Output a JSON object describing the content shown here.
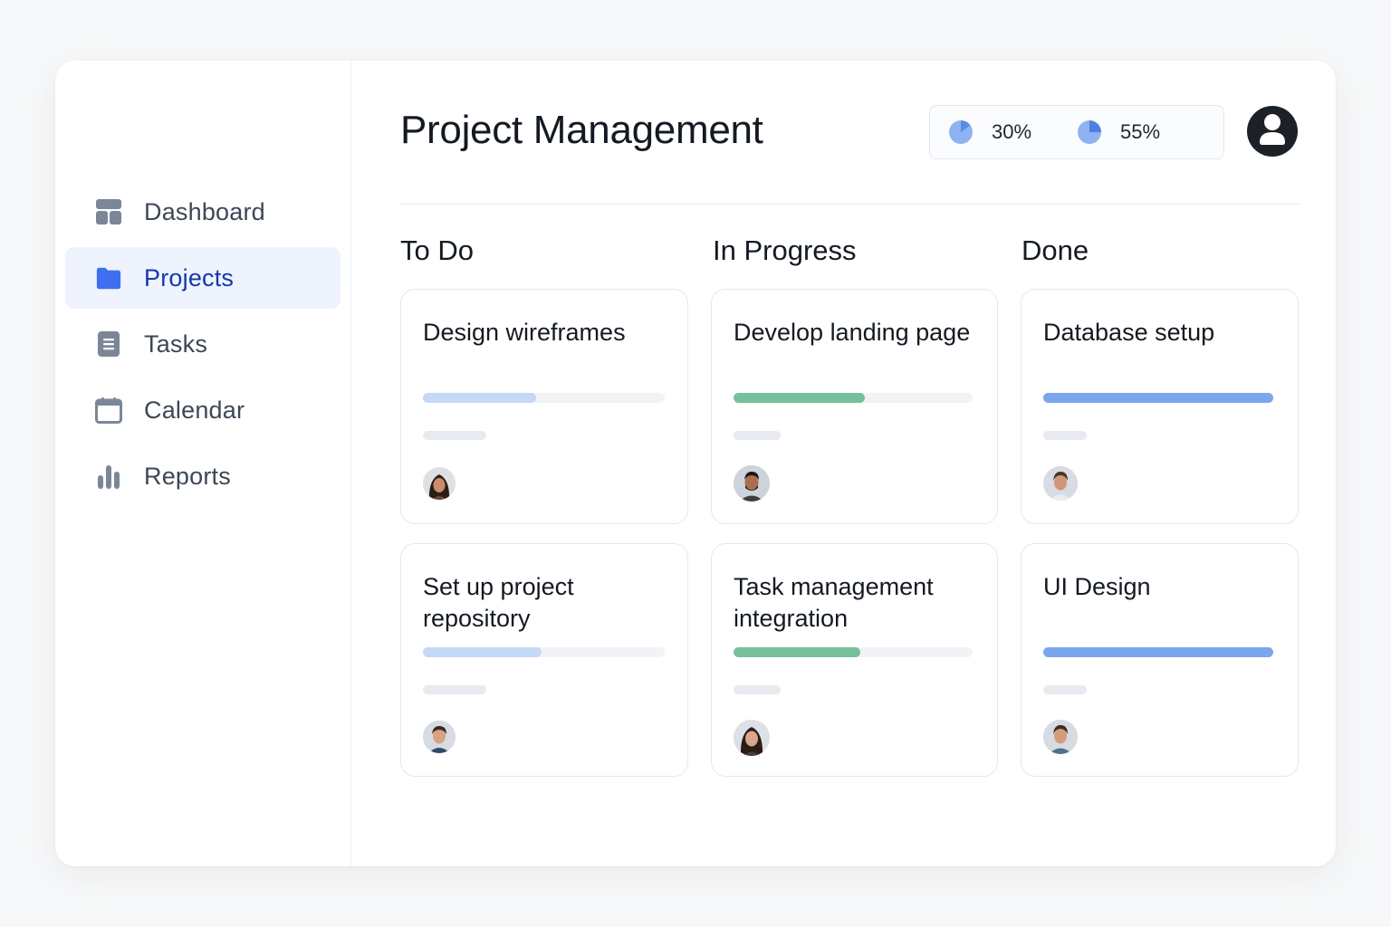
{
  "sidebar": {
    "items": [
      {
        "label": "Dashboard",
        "icon": "dashboard-icon",
        "active": false
      },
      {
        "label": "Projects",
        "icon": "folder-icon",
        "active": true
      },
      {
        "label": "Tasks",
        "icon": "document-icon",
        "active": false
      },
      {
        "label": "Calendar",
        "icon": "calendar-icon",
        "active": false
      },
      {
        "label": "Reports",
        "icon": "bar-chart-icon",
        "active": false
      }
    ]
  },
  "header": {
    "title": "Project Management",
    "stats": [
      {
        "label": "30%",
        "value": 0.3,
        "icon": "pie-chart-icon"
      },
      {
        "label": "55%",
        "value": 0.55,
        "icon": "pie-chart-icon"
      }
    ],
    "profile_icon": "user-icon"
  },
  "board": {
    "columns": [
      {
        "title": "To Do",
        "cards": [
          {
            "title": "Design wireframes",
            "progress": 0.47,
            "bar_color": "#c4d8f8",
            "avatar": "avatar-woman"
          },
          {
            "title": "Set up project repository",
            "progress": 0.49,
            "bar_color": "#c4d8f8",
            "avatar": "avatar-man"
          }
        ]
      },
      {
        "title": "In Progress",
        "cards": [
          {
            "title": "Develop landing page",
            "progress": 0.55,
            "bar_color": "#76c09b",
            "avatar": "avatar-man"
          },
          {
            "title": "Task management integration",
            "progress": 0.53,
            "bar_color": "#76c09b",
            "avatar": "avatar-woman"
          }
        ]
      },
      {
        "title": "Done",
        "cards": [
          {
            "title": "Database setup",
            "progress": 1.0,
            "bar_color": "#7aa6ec",
            "avatar": "avatar-man"
          },
          {
            "title": "UI Design",
            "progress": 1.0,
            "bar_color": "#7aa6ec",
            "avatar": "avatar-man"
          }
        ]
      }
    ]
  },
  "colors": {
    "accent": "#3f6ff0",
    "active_bg": "#eef3fe",
    "active_text": "#1538a8",
    "nav_icon": "#7b8797"
  }
}
